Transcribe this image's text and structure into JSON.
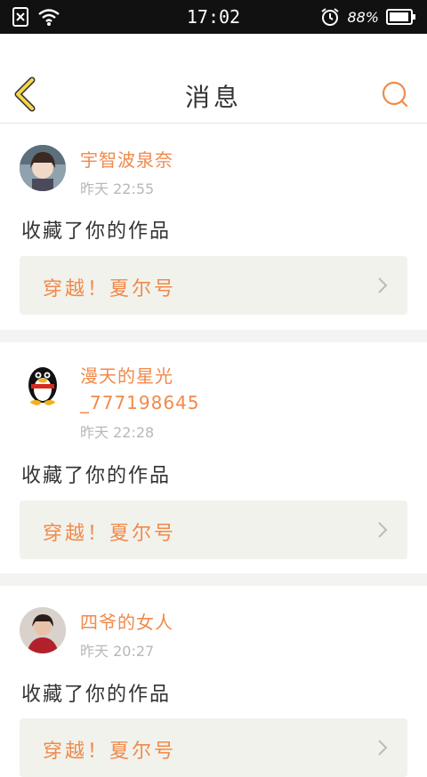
{
  "status_bar": {
    "time": "17:02",
    "battery_pct": "88%"
  },
  "header": {
    "title": "消息"
  },
  "colors": {
    "accent": "#f08a4b",
    "back_arrow": "#f3d64a",
    "work_bg": "#f2f2ec"
  },
  "messages": [
    {
      "user": "宇智波泉奈",
      "time": "昨天 22:55",
      "action": "收藏了你的作品",
      "work_title": "穿越！夏尔号"
    },
    {
      "user": "漫天的星光",
      "user_line2": "_777198645",
      "time": "昨天 22:28",
      "action": "收藏了你的作品",
      "work_title": "穿越！夏尔号"
    },
    {
      "user": "四爷的女人",
      "time": "昨天 20:27",
      "action": "收藏了你的作品",
      "work_title": "穿越！夏尔号"
    }
  ]
}
